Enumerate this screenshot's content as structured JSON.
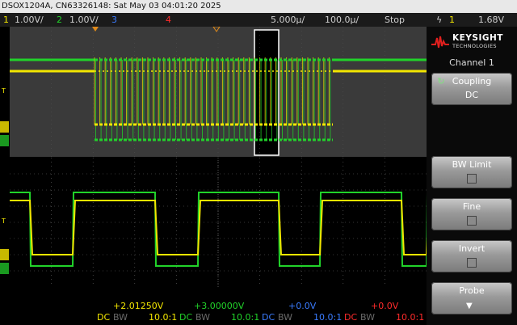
{
  "title_bar": "DSOX1204A, CN63326148: Sat May 03 04:01:20 2025",
  "status": {
    "ch1_num": "1",
    "ch1_scale": "1.00V/",
    "ch2_num": "2",
    "ch2_scale": "1.00V/",
    "ch3_num": "3",
    "ch4_num": "4",
    "timebase": "5.000µ/",
    "delay": "100.0µ/",
    "run_state": "Stop",
    "trigger_icon": "ϟ",
    "trigger_channel": "1",
    "trigger_level": "1.68V"
  },
  "brand": {
    "name": "KEYSIGHT",
    "sub": "TECHNOLOGIES"
  },
  "panel": {
    "title": "Channel 1",
    "buttons": [
      {
        "label": "Coupling",
        "value": "DC"
      },
      {
        "label": "BW Limit"
      },
      {
        "label": "Fine"
      },
      {
        "label": "Invert"
      },
      {
        "label": "Probe"
      }
    ]
  },
  "channels": [
    {
      "offset": "+2.01250V",
      "coupling": "DC",
      "bw": "BW",
      "probe": "10.0:1",
      "color": "#f2e600"
    },
    {
      "offset": "+3.00000V",
      "coupling": "DC",
      "bw": "BW",
      "probe": "10.0:1",
      "color": "#21d32a"
    },
    {
      "offset": "+0.0V",
      "coupling": "DC",
      "bw": "BW",
      "probe": "10.0:1",
      "color": "#3a7cff"
    },
    {
      "offset": "+0.0V",
      "coupling": "DC",
      "bw": "BW",
      "probe": "10.0:1",
      "color": "#ff2b2b"
    }
  ],
  "markers": {
    "trigger_t": "T",
    "ch1": "1",
    "ch2": "2"
  },
  "colors": {
    "ch1": "#f2e600",
    "ch2": "#21d32a",
    "ch3": "#3a7cff",
    "ch4": "#ff2b2b",
    "grid": "#6b6b6b"
  }
}
